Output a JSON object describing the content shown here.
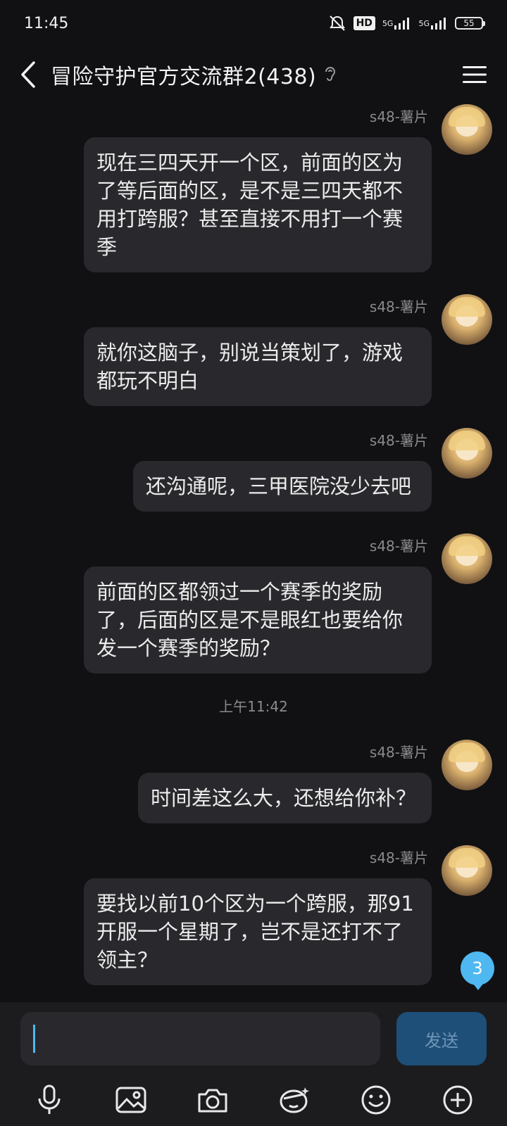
{
  "status_bar": {
    "time": "11:45",
    "hd": "HD",
    "net1": "5G",
    "net2": "5G",
    "battery": "55"
  },
  "header": {
    "title": "冒险守护官方交流群2(438)"
  },
  "messages": [
    {
      "sender": "s48-薯片",
      "text": "现在三四天开一个区，前面的区为\n了等后面的区，是不是三四天都不\n用打跨服？甚至直接不用打一个赛\n季"
    },
    {
      "sender": "s48-薯片",
      "text": "就你这脑子，别说当策划了，游戏\n都玩不明白"
    },
    {
      "sender": "s48-薯片",
      "text": "还沟通呢，三甲医院没少去吧"
    },
    {
      "sender": "s48-薯片",
      "text": "前面的区都领过一个赛季的奖励\n了，后面的区是不是眼红也要给你\n发一个赛季的奖励？"
    },
    {
      "sender": "s48-薯片",
      "text": "时间差这么大，还想给你补？"
    },
    {
      "sender": "s48-薯片",
      "text": "要找以前10个区为一个跨服，那91\n开服一个星期了，岂不是还打不了\n领主？"
    }
  ],
  "timestamp": "上午11:42",
  "unread_count": "3",
  "composer": {
    "input_value": "",
    "send_label": "发送"
  },
  "toolbar": {
    "icons": [
      "microphone-icon",
      "image-icon",
      "camera-icon",
      "sticker-icon",
      "emoji-icon",
      "plus-icon"
    ]
  },
  "colors": {
    "background": "#111114",
    "bubble": "#29292d",
    "accent": "#4fb8f0",
    "send_button": "#1d4f79"
  }
}
